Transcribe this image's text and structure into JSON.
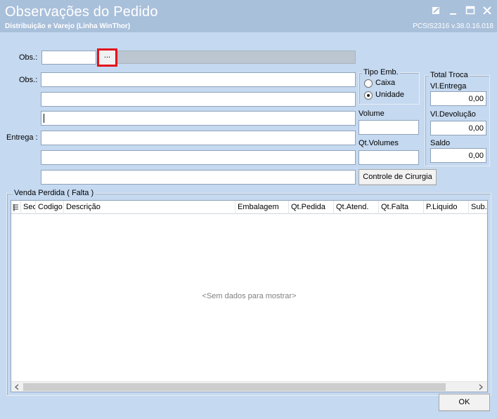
{
  "window": {
    "title": "Observações do Pedido",
    "subtitle": "Distribuição e Varejo (Linha WinThor)",
    "code": "PCSIS2316  v.38.0.16.018",
    "buttons": {
      "restore_icon": "restore-icon",
      "minimize_icon": "minimize-icon",
      "maximize_icon": "maximize-icon",
      "close_icon": "close-icon"
    }
  },
  "form": {
    "obs_label_1": "Obs.:",
    "obs_code_value": "",
    "ellipsis_label": "...",
    "obs_label_2": "Obs.:",
    "entrega_label": "Entrega :",
    "obs_lines": [
      "",
      "",
      "",
      ""
    ],
    "entrega_lines": [
      "",
      ""
    ]
  },
  "tipo_emb": {
    "caption": "Tipo Emb.",
    "options": [
      {
        "label": "Caixa",
        "selected": false
      },
      {
        "label": "Unidade",
        "selected": true
      }
    ]
  },
  "volume": {
    "volume_label": "Volume",
    "volume_value": "",
    "qt_volumes_label": "Qt.Volumes",
    "qt_volumes_value": ""
  },
  "cirurgia_button": "Controle de Cirurgia",
  "total_troca": {
    "caption": "Total Troca",
    "vl_entrega_label": "Vl.Entrega",
    "vl_entrega_value": "0,00",
    "vl_devolucao_label": "Vl.Devolução",
    "vl_devolucao_value": "0,00",
    "saldo_label": "Saldo",
    "saldo_value": "0,00"
  },
  "venda_perdida": {
    "caption": "Venda Perdida ( Falta )",
    "columns": [
      "Sec",
      "Codigo",
      "Descrição",
      "Embalagem",
      "Qt.Pedida",
      "Qt.Atend.",
      "Qt.Falta",
      "P.Liquido",
      "Sub.T"
    ],
    "rows": [],
    "empty_message": "<Sem dados para mostrar>"
  },
  "ok_button": "OK",
  "colors": {
    "title_bar": "#a9c0db",
    "background": "#c5d9f0",
    "highlight": "#e1141b"
  }
}
